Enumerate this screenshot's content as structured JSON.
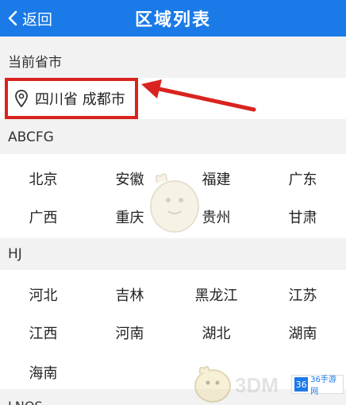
{
  "header": {
    "back_label": "返回",
    "title": "区域列表"
  },
  "current": {
    "section_label": "当前省市",
    "location": "四川省 成都市"
  },
  "groups": [
    {
      "label": "ABCFG",
      "items": [
        "北京",
        "安徽",
        "福建",
        "广东",
        "广西",
        "重庆",
        "贵州",
        "甘肃"
      ]
    },
    {
      "label": "HJ",
      "items": [
        "河北",
        "吉林",
        "黑龙江",
        "江苏",
        "江西",
        "河南",
        "湖北",
        "湖南",
        "海南"
      ]
    }
  ],
  "next_group_partial": "LNQS",
  "watermark": {
    "text": "3DM"
  },
  "badge": {
    "mark": "36",
    "text": "36手游网"
  },
  "colors": {
    "header": "#1a7ae8",
    "highlight": "#d9231f",
    "arrow": "#d9231f"
  }
}
